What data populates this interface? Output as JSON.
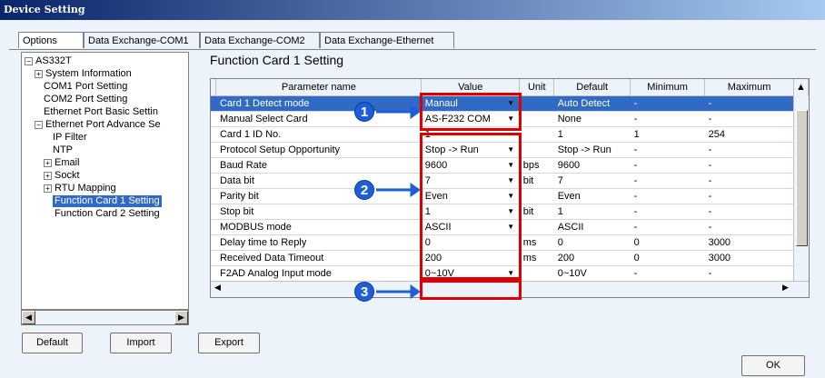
{
  "window": {
    "title": "Device Setting"
  },
  "tabs": [
    "Options",
    "Data Exchange-COM1",
    "Data Exchange-COM2",
    "Data Exchange-Ethernet"
  ],
  "tree": {
    "root": "AS332T",
    "items": [
      "System Information",
      "COM1 Port Setting",
      "COM2 Port Setting",
      "Ethernet Port Basic Settin",
      "Ethernet Port Advance Se",
      "IP Filter",
      "NTP",
      "Email",
      "Sockt",
      "RTU Mapping",
      "Function Card 1 Setting",
      "Function Card 2 Setting"
    ]
  },
  "section_title": "Function Card 1 Setting",
  "grid": {
    "columns": [
      "Parameter name",
      "Value",
      "Unit",
      "Default",
      "Minimum",
      "Maximum"
    ],
    "rows": [
      {
        "name": "Card 1 Detect mode",
        "value": "Manaul",
        "unit": "",
        "default": "Auto Detect",
        "min": "-",
        "max": "-"
      },
      {
        "name": "Manual Select Card",
        "value": "AS-F232 COM",
        "unit": "",
        "default": "None",
        "min": "-",
        "max": "-"
      },
      {
        "name": "Card 1 ID No.",
        "value": "1",
        "unit": "",
        "default": "1",
        "min": "1",
        "max": "254"
      },
      {
        "name": "Protocol Setup Opportunity",
        "value": "Stop -> Run",
        "unit": "",
        "default": "Stop -> Run",
        "min": "-",
        "max": "-"
      },
      {
        "name": "Baud Rate",
        "value": "9600",
        "unit": "bps",
        "default": "9600",
        "min": "-",
        "max": "-"
      },
      {
        "name": "Data bit",
        "value": "7",
        "unit": "bit",
        "default": "7",
        "min": "-",
        "max": "-"
      },
      {
        "name": "Parity bit",
        "value": "Even",
        "unit": "",
        "default": "Even",
        "min": "-",
        "max": "-"
      },
      {
        "name": "Stop bit",
        "value": "1",
        "unit": "bit",
        "default": "1",
        "min": "-",
        "max": "-"
      },
      {
        "name": "MODBUS mode",
        "value": "ASCII",
        "unit": "",
        "default": "ASCII",
        "min": "-",
        "max": "-"
      },
      {
        "name": "Delay time to Reply",
        "value": "0",
        "unit": "ms",
        "default": "0",
        "min": "0",
        "max": "3000"
      },
      {
        "name": "Received Data Timeout",
        "value": "200",
        "unit": "ms",
        "default": "200",
        "min": "0",
        "max": "3000"
      },
      {
        "name": "F2AD Analog Input mode",
        "value": "0~10V",
        "unit": "",
        "default": "0~10V",
        "min": "-",
        "max": "-"
      }
    ]
  },
  "callouts": [
    "1",
    "2",
    "3"
  ],
  "buttons": {
    "default": "Default",
    "import": "Import",
    "export": "Export",
    "ok": "OK"
  },
  "colors": {
    "selection": "#316ac5",
    "highlight_box": "#e00000",
    "callout": "#1e5fd8"
  }
}
